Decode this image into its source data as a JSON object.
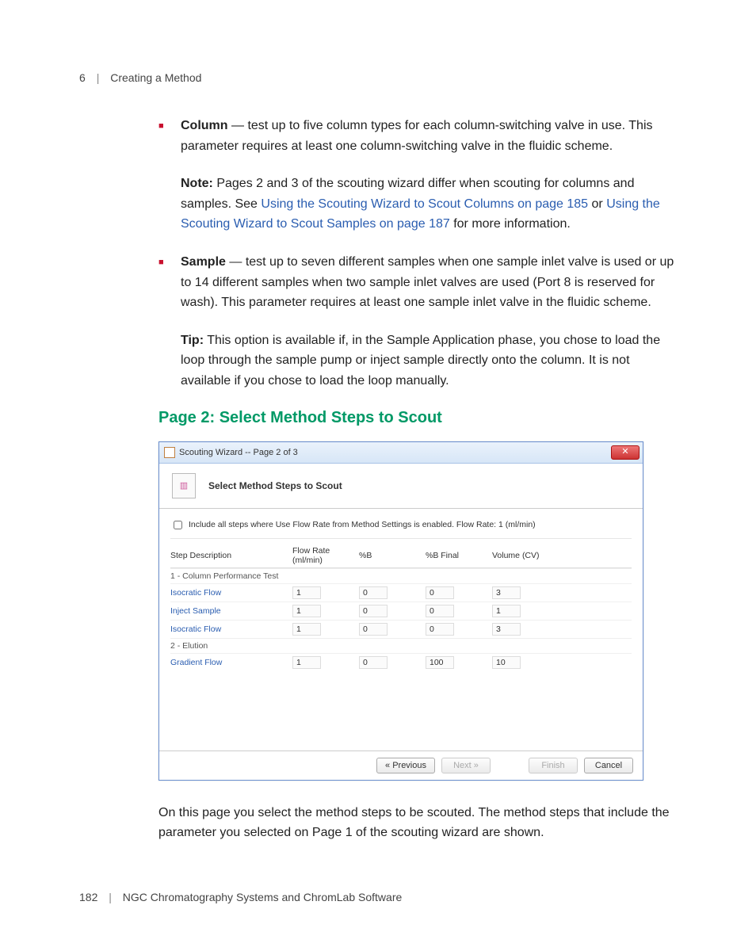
{
  "header": {
    "chapter_num": "6",
    "chapter_title": "Creating a Method"
  },
  "bullets": {
    "column": {
      "label": "Column",
      "body_after": " — test up to five column types for each column-switching valve in use. This parameter requires at least one column-switching valve in the fluidic scheme."
    },
    "note": {
      "label": "Note:",
      "t1": "  Pages 2 and 3 of the scouting wizard differ when scouting for columns and samples. See ",
      "link1": "Using the Scouting Wizard to Scout Columns on page 185",
      "t2": " or ",
      "link2": "Using the Scouting Wizard to Scout Samples on page 187",
      "t3": " for more information."
    },
    "sample": {
      "label": "Sample",
      "body_after": " — test up to seven different samples when one sample inlet valve is used or up to 14 different samples when two sample inlet valves are used (Port 8 is reserved for wash). This parameter requires at least one sample inlet valve in the fluidic scheme."
    },
    "tip": {
      "label": "Tip:",
      "body": "  This option is available if, in the Sample Application phase, you chose to load the loop through the sample pump or inject sample directly onto the column. It is not available if you chose to load the loop manually."
    }
  },
  "section_heading": "Page 2: Select Method Steps to Scout",
  "wizard": {
    "title": "Scouting Wizard -- Page 2 of 3",
    "header_text": "Select Method Steps to Scout",
    "checkbox_label": "Include all steps where Use Flow Rate from Method Settings is enabled. Flow Rate: 1 (ml/min)",
    "columns": [
      "Step Description",
      "Flow Rate (ml/min)",
      "%B",
      "%B Final",
      "Volume (CV)"
    ],
    "group1": "1 - Column Performance Test",
    "rows1": [
      {
        "desc": "Isocratic Flow",
        "fr": "1",
        "pb": "0",
        "pbf": "0",
        "vol": "3"
      },
      {
        "desc": "Inject Sample",
        "fr": "1",
        "pb": "0",
        "pbf": "0",
        "vol": "1"
      },
      {
        "desc": "Isocratic Flow",
        "fr": "1",
        "pb": "0",
        "pbf": "0",
        "vol": "3"
      }
    ],
    "group2": "2 - Elution",
    "rows2": [
      {
        "desc": "Gradient Flow",
        "fr": "1",
        "pb": "0",
        "pbf": "100",
        "vol": "10"
      }
    ],
    "buttons": {
      "prev": "« Previous",
      "next": "Next »",
      "finish": "Finish",
      "cancel": "Cancel"
    }
  },
  "trailing": "On this page you select the method steps to be scouted. The method steps that include the parameter you selected on Page 1 of the scouting wizard are shown.",
  "footer": {
    "page_num": "182",
    "doc_title": "NGC Chromatography Systems and ChromLab Software"
  }
}
